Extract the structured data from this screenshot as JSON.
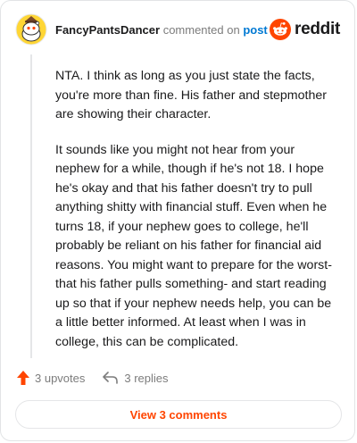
{
  "header": {
    "username": "FancyPantsDancer",
    "action": "commented on",
    "link": "post",
    "brand": "reddit"
  },
  "comment": {
    "paragraphs": [
      "NTA. I think as long as you just state the facts, you're more than fine. His father and stepmother are showing their character.",
      "It sounds like you might not hear from your nephew for a while, though if he's not 18. I hope he's okay and that his father doesn't try to pull anything shitty with financial stuff. Even when he turns 18, if your nephew goes to college, he'll probably be reliant on his father for financial aid reasons. You might want to prepare for the worst- that his father pulls something- and start reading up so that if your nephew needs help, you can be a little better informed. At least when I was in college, this can be complicated."
    ]
  },
  "actions": {
    "upvotes": "3 upvotes",
    "replies": "3 replies"
  },
  "view_button": "View 3 comments",
  "colors": {
    "accent": "#ff4500",
    "link": "#0079d3",
    "muted": "#7c7c7c",
    "border": "#e2e4e6"
  },
  "icons": {
    "avatar": "snoo-avatar-icon",
    "logo": "reddit-logo-icon",
    "upvote": "upvote-arrow-icon",
    "reply": "reply-arrow-icon"
  }
}
